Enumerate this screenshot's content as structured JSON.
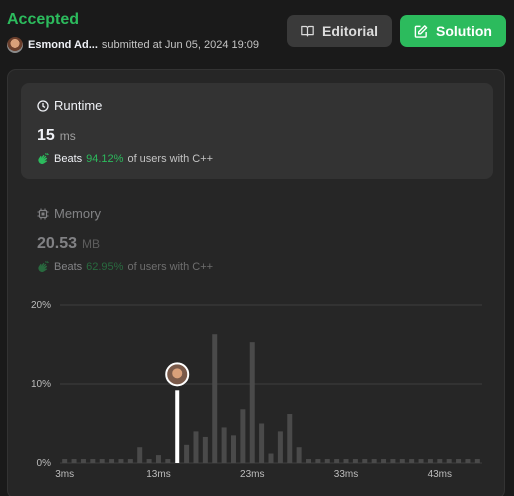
{
  "header": {
    "status": "Accepted",
    "user_name": "Esmond Ad...",
    "submitted_text": "submitted at Jun 05, 2024 19:09",
    "editorial_label": "Editorial",
    "solution_label": "Solution"
  },
  "runtime": {
    "title": "Runtime",
    "value": "15",
    "unit": "ms",
    "beats_label": "Beats",
    "beats_pct": "94.12%",
    "beats_suffix": "of users with C++"
  },
  "memory": {
    "title": "Memory",
    "value": "20.53",
    "unit": "MB",
    "beats_label": "Beats",
    "beats_pct": "62.95%",
    "beats_suffix": "of users with C++"
  },
  "colors": {
    "accent": "#2cbb5d",
    "card": "#333333",
    "panel": "#262626"
  },
  "chart_data": {
    "type": "bar",
    "x_tick_labels": [
      "3ms",
      "13ms",
      "23ms",
      "33ms",
      "43ms"
    ],
    "x_ticks": [
      3,
      13,
      23,
      33,
      43
    ],
    "y_tick_labels": [
      "0%",
      "10%",
      "20%"
    ],
    "y_ticks": [
      0,
      10,
      20
    ],
    "ylim": [
      0,
      20
    ],
    "xlim": [
      3,
      47
    ],
    "highlight_x": 15,
    "categories": [
      3,
      4,
      5,
      6,
      7,
      8,
      9,
      10,
      11,
      12,
      13,
      14,
      15,
      16,
      17,
      18,
      19,
      20,
      21,
      22,
      23,
      24,
      25,
      26,
      27,
      28,
      29,
      30,
      31,
      32,
      33,
      34,
      35,
      36,
      37,
      38,
      39,
      40,
      41,
      42,
      43,
      44,
      45,
      46,
      47
    ],
    "values": [
      0.5,
      0.5,
      0.5,
      0.5,
      0.5,
      0.5,
      0.5,
      0.5,
      2.0,
      0.5,
      1.0,
      0.5,
      9.2,
      2.3,
      4.0,
      3.3,
      16.3,
      4.5,
      3.5,
      6.8,
      15.3,
      5.0,
      1.2,
      4.0,
      6.2,
      2.0,
      0.5,
      0.5,
      0.5,
      0.5,
      0.5,
      0.5,
      0.5,
      0.5,
      0.5,
      0.5,
      0.5,
      0.5,
      0.5,
      0.5,
      0.5,
      0.5,
      0.5,
      0.5,
      0.5
    ]
  }
}
